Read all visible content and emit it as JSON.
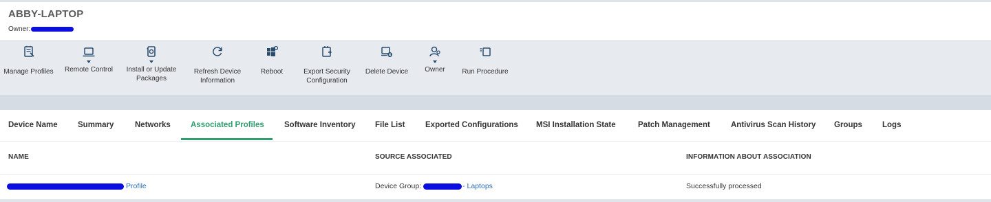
{
  "device": {
    "title": "ABBY-LAPTOP",
    "owner_label": "Owner:"
  },
  "toolbar": [
    {
      "label": "Manage Profiles",
      "icon": "manage-profiles-icon",
      "caret": false
    },
    {
      "label": "Remote Control",
      "icon": "laptop-icon",
      "caret": true
    },
    {
      "label": "Install or Update\nPackages",
      "icon": "install-package-icon",
      "caret": true
    },
    {
      "label": "Refresh Device\nInformation",
      "icon": "refresh-icon",
      "caret": false
    },
    {
      "label": "Reboot",
      "icon": "windows-reboot-icon",
      "caret": false
    },
    {
      "label": "Export Security\nConfiguration",
      "icon": "export-icon",
      "caret": false
    },
    {
      "label": "Delete Device",
      "icon": "delete-device-icon",
      "caret": false
    },
    {
      "label": "Owner",
      "icon": "owner-icon",
      "caret": true
    },
    {
      "label": "Run Procedure",
      "icon": "run-procedure-icon",
      "caret": false
    }
  ],
  "tabs": [
    {
      "label": "Device Name"
    },
    {
      "label": "Summary"
    },
    {
      "label": "Networks"
    },
    {
      "label": "Associated Profiles",
      "active": true
    },
    {
      "label": "Software Inventory"
    },
    {
      "label": "File List"
    },
    {
      "label": "Exported Configurations"
    },
    {
      "label": "MSI Installation State"
    },
    {
      "label": "Patch Management"
    },
    {
      "label": "Antivirus Scan History"
    },
    {
      "label": "Groups"
    },
    {
      "label": "Logs"
    }
  ],
  "table": {
    "columns": [
      "NAME",
      "SOURCE ASSOCIATED",
      "INFORMATION ABOUT ASSOCIATION"
    ],
    "rows": [
      {
        "name_link": "Profile",
        "source_prefix": "Device Group:",
        "source_link": "- Laptops",
        "info": "Successfully processed"
      }
    ]
  },
  "colors": {
    "accent": "#2f9e6e",
    "link": "#2f6db5",
    "redaction": "#0a0fe0",
    "icon": "#2a4d6e"
  }
}
